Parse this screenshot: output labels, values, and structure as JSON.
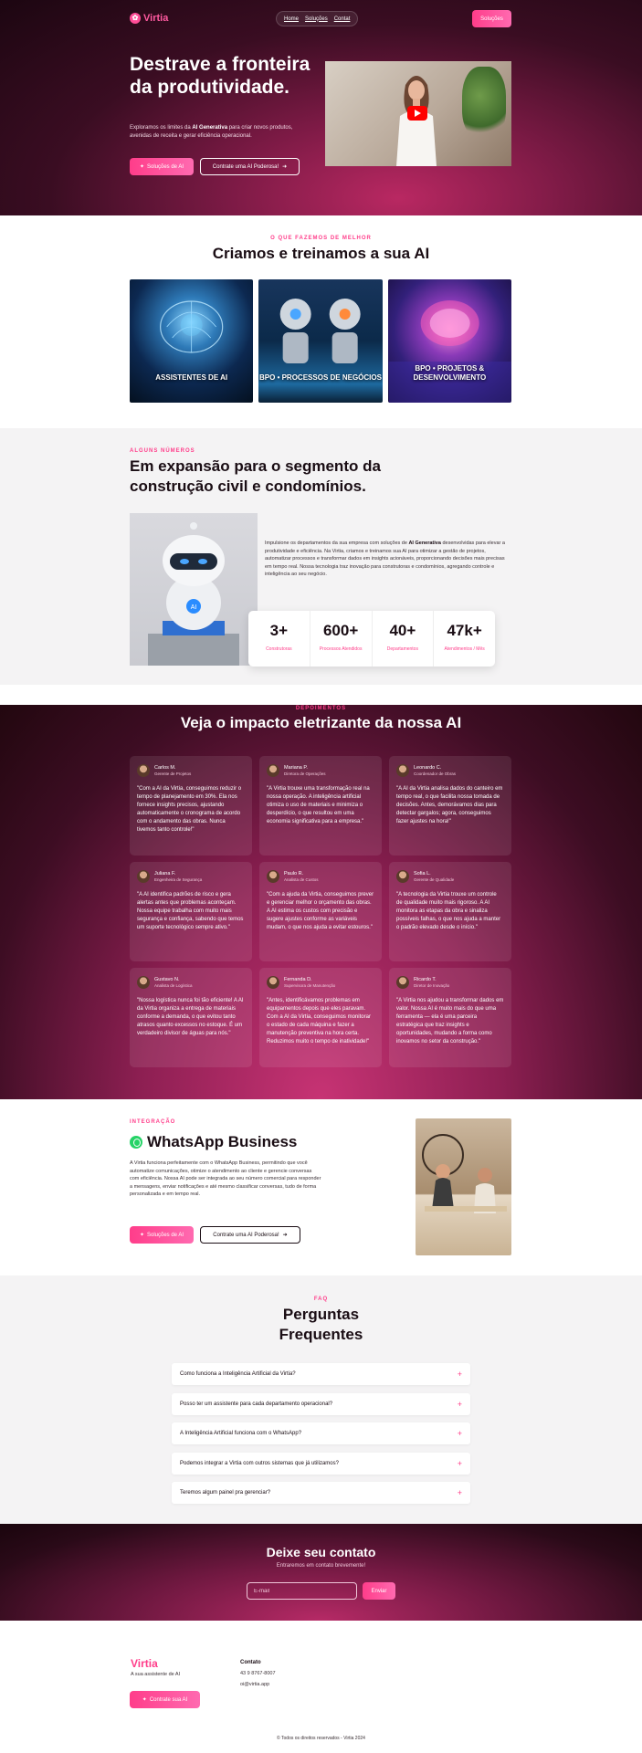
{
  "brand": {
    "name": "Virtia",
    "accent": "#ff3d8a",
    "dark": "#1a0d14"
  },
  "nav": {
    "items": [
      "Home",
      "Soluções",
      "Contat"
    ],
    "cta": "Soluções"
  },
  "hero": {
    "title": "Destrave a fronteira da produtividade.",
    "desc_pre": "Exploramos os limites da ",
    "desc_bold": "AI Generativa",
    "desc_post": " para criar novos produtos, avenidas de receita e gerar eficiência operacional.",
    "btn_primary": "Soluções de AI",
    "btn_secondary": "Contrate uma AI Poderosa!",
    "video_icon": "youtube-play-icon"
  },
  "services": {
    "eyebrow": "O QUE FAZEMOS DE MELHOR",
    "title": "Criamos e treinamos a sua AI",
    "cards": [
      {
        "label": "ASSISTENTES DE AI"
      },
      {
        "label": "BPO • PROCESSOS DE NEGÓCIOS"
      },
      {
        "label": "BPO • PROJETOS & DESENVOLVIMENTO"
      }
    ]
  },
  "stats": {
    "eyebrow": "ALGUNS NÚMEROS",
    "title": "Em expansão para o segmento da construção civil e condomínios.",
    "desc_pre": "Impulsione os departamentos da sua empresa com soluções de ",
    "desc_bold": "AI Generativa",
    "desc_post": " desenvolvidas para elevar a produtividade e eficiência. Na Virtia, criamos e treinamos sua AI para otimizar a gestão de projetos, automatizar processos e transformar dados em insights acionáveis, proporcionando decisões mais precisas em tempo real. Nossa tecnologia traz inovação para construtoras e condomínios, agregando controle e inteligência ao seu negócio.",
    "items": [
      {
        "value": "3+",
        "label": "Construtoras"
      },
      {
        "value": "600+",
        "label": "Processos Atendidos"
      },
      {
        "value": "40+",
        "label": "Departamentos"
      },
      {
        "value": "47k+",
        "label": "Atendimentos / Mês"
      }
    ]
  },
  "testimonials": {
    "eyebrow": "DEPOIMENTOS",
    "title": "Veja o impacto eletrizante da nossa AI",
    "items": [
      {
        "name": "Carlos M.",
        "role": "Gerente de Projetos",
        "quote": "\"Com a AI da Virtia, conseguimos reduzir o tempo de planejamento em 30%. Ela nos fornece insights precisos, ajustando automaticamente o cronograma de acordo com o andamento das obras. Nunca tivemos tanto controle!\""
      },
      {
        "name": "Mariana P.",
        "role": "Diretora de Operações",
        "quote": "\"A Virtia trouxe uma transformação real na nossa operação. A inteligência artificial otimiza o uso de materiais e minimiza o desperdício, o que resultou em uma economia significativa para a empresa.\""
      },
      {
        "name": "Leonardo C.",
        "role": "Coordenador de Obras",
        "quote": "\"A AI da Virtia analisa dados do canteiro em tempo real, o que facilita nossa tomada de decisões. Antes, demorávamos dias para detectar gargalos; agora, conseguimos fazer ajustes na hora!\""
      },
      {
        "name": "Juliana F.",
        "role": "Engenheira de Segurança",
        "quote": "\"A AI identifica padrões de risco e gera alertas antes que problemas aconteçam. Nossa equipe trabalha com muito mais segurança e confiança, sabendo que temos um suporte tecnológico sempre ativo.\""
      },
      {
        "name": "Paulo R.",
        "role": "Analista de Custos",
        "quote": "\"Com a ajuda da Virtia, conseguimos prever e gerenciar melhor o orçamento das obras. A AI estima os custos com precisão e sugere ajustes conforme as variáveis mudam, o que nos ajuda a evitar estouros.\""
      },
      {
        "name": "Sofia L.",
        "role": "Gerente de Qualidade",
        "quote": "\"A tecnologia da Virtia trouxe um controle de qualidade muito mais rigoroso. A AI monitora as etapas da obra e sinaliza possíveis falhas, o que nos ajuda a manter o padrão elevado desde o início.\""
      },
      {
        "name": "Gustavo N.",
        "role": "Analista de Logística",
        "quote": "\"Nossa logística nunca foi tão eficiente! A AI da Virtia organiza a entrega de materiais conforme a demanda, o que evitou tanto atrasos quanto excessos no estoque. É um verdadeiro divisor de águas para nós.\""
      },
      {
        "name": "Fernanda D.",
        "role": "Supervisora de Manutenção",
        "quote": "\"Antes, identificávamos problemas em equipamentos depois que eles paravam. Com a AI da Virtia, conseguimos monitorar o estado de cada máquina e fazer a manutenção preventiva na hora certa. Reduzimos muito o tempo de inatividade!\""
      },
      {
        "name": "Ricardo T.",
        "role": "Diretor de Inovação",
        "quote": "\"A Virtia nos ajudou a transformar dados em valor. Nossa AI é muito mais do que uma ferramenta — ela é uma parceira estratégica que traz insights e oportunidades, mudando a forma como inovamos no setor da construção.\""
      }
    ]
  },
  "whatsapp": {
    "eyebrow": "INTEGRAÇÃO",
    "title": "WhatsApp Business",
    "desc": "A Virtia funciona perfeitamente com o WhatsApp Business, permitindo que você automatize comunicações, otimize o atendimento ao cliente e gerencie conversas com eficiência. Nossa AI pode ser integrada ao seu número comercial para responder a mensagens, enviar notificações e até mesmo classificar conversas, tudo de forma personalizada e em tempo real.",
    "btn_primary": "Soluções de AI",
    "btn_secondary": "Contrate uma AI Poderosa!"
  },
  "faq": {
    "eyebrow": "FAQ",
    "title_line1": "Perguntas",
    "title_line2": "Frequentes",
    "items": [
      "Como funciona a Inteligência Artificial da Virtia?",
      "Posso ter um assistente para cada departamento operacional?",
      "A Inteligência Artificial funciona com o WhatsApp?",
      "Podemos integrar a Virtia com outros sistemas que já utilizamos?",
      "Teremos algum painel pra gerenciar?"
    ]
  },
  "contact": {
    "title": "Deixe seu contato",
    "subtitle": "Entraremos em contato brevemente!",
    "email_placeholder": "E-mail",
    "submit": "Enviar"
  },
  "footer": {
    "brand": "Virtia",
    "tagline": "A sua assistente de AI",
    "btn": "Contrate sua AI",
    "contact_heading": "Contato",
    "phone": "43 9 8767-8007",
    "email": "oi@virtia.app",
    "copyright": "© Todos os direitos reservados - Virtia 2024"
  }
}
